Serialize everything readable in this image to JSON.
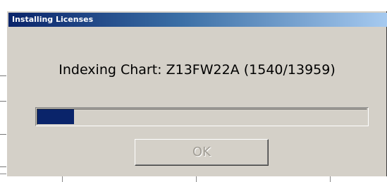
{
  "dialog": {
    "title": "Installing Licenses",
    "message": "Indexing Chart: Z13FW22A (1540/13959)",
    "progress_fraction": 0.1103,
    "ok_label": "OK",
    "ok_enabled": false
  },
  "colors": {
    "titlebar_start": "#0a246a",
    "titlebar_end": "#a6caf0",
    "dialog_face": "#d4d0c8",
    "progress_fill": "#0a246a"
  }
}
